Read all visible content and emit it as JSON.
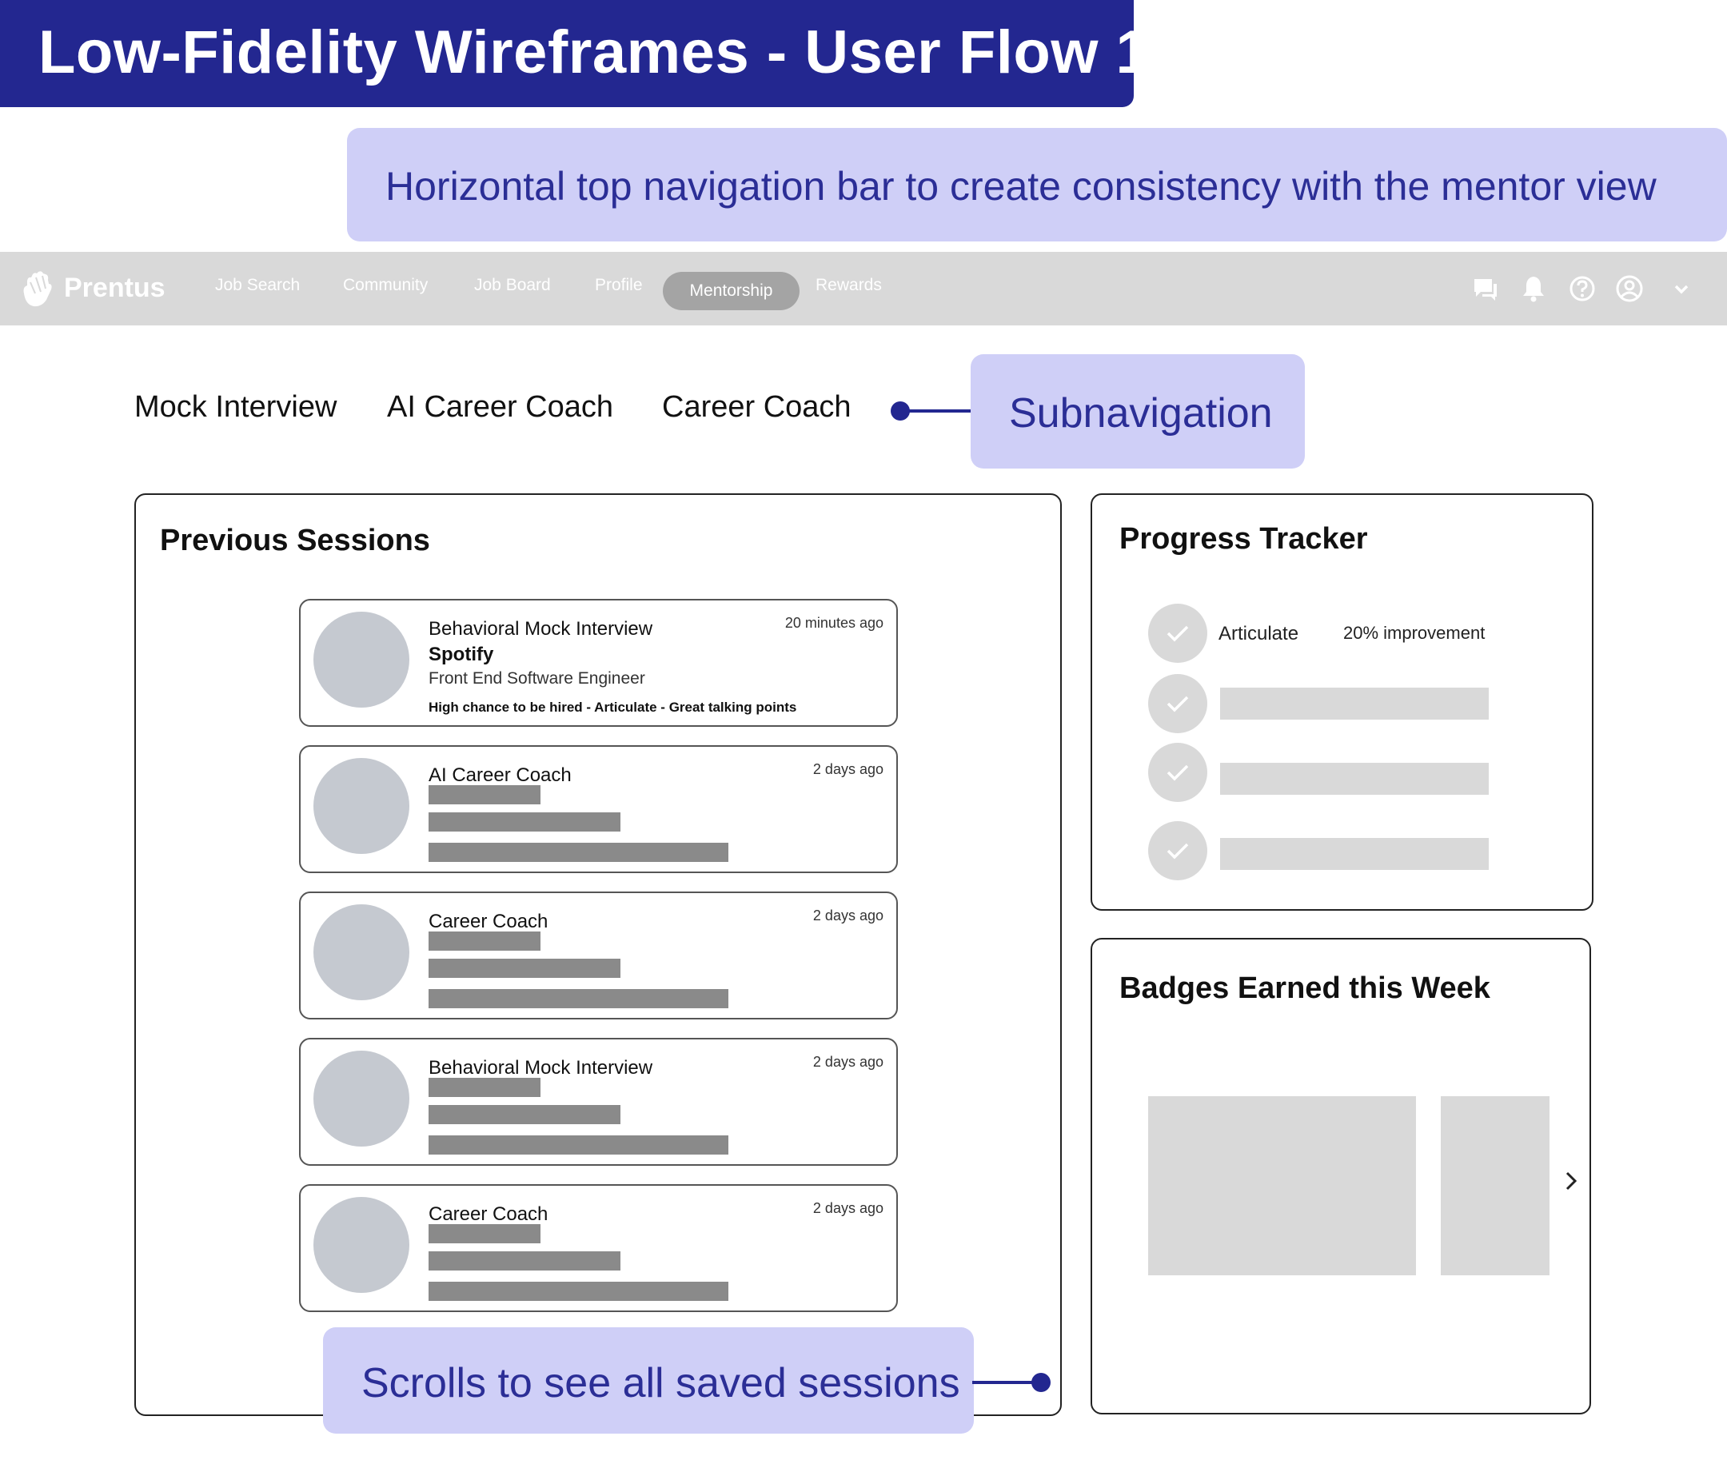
{
  "title": "Low-Fidelity Wireframes - User Flow 1",
  "callouts": {
    "top": "Horizontal top navigation bar to create consistency with the mentor view",
    "subnav": "Subnavigation",
    "scroll": "Scrolls to see all saved sessions"
  },
  "navbar": {
    "logo": "Prentus",
    "items": [
      "Job Search",
      "Community",
      "Job Board",
      "Profile",
      "Mentorship",
      "Rewards"
    ],
    "active": "Mentorship",
    "icons": [
      "chat-icon",
      "bell-icon",
      "help-icon",
      "profile-icon",
      "chevron-down-icon"
    ]
  },
  "subnav": [
    "Mock Interview",
    "AI Career Coach",
    "Career Coach"
  ],
  "previous_sessions": {
    "title": "Previous Sessions",
    "items": [
      {
        "title": "Behavioral Mock Interview",
        "time": "20 minutes ago",
        "company": "Spotify",
        "role": "Front End Software Engineer",
        "tags": "High chance to be hired - Articulate -  Great talking points"
      },
      {
        "title": "AI Career Coach",
        "time": "2 days ago"
      },
      {
        "title": "Career Coach",
        "time": "2 days ago"
      },
      {
        "title": "Behavioral Mock Interview",
        "time": "2 days ago"
      },
      {
        "title": "Career Coach",
        "time": "2 days ago"
      }
    ]
  },
  "progress_tracker": {
    "title": "Progress Tracker",
    "first_label": "Articulate",
    "first_value": "20% improvement"
  },
  "badges": {
    "title": "Badges Earned this Week"
  },
  "colors": {
    "primary": "#232790",
    "callout_bg": "#cfcff7",
    "callout_text": "#2b2e96",
    "navbar_bg": "#d9d9d9",
    "placeholder": "#8a8a8a"
  }
}
